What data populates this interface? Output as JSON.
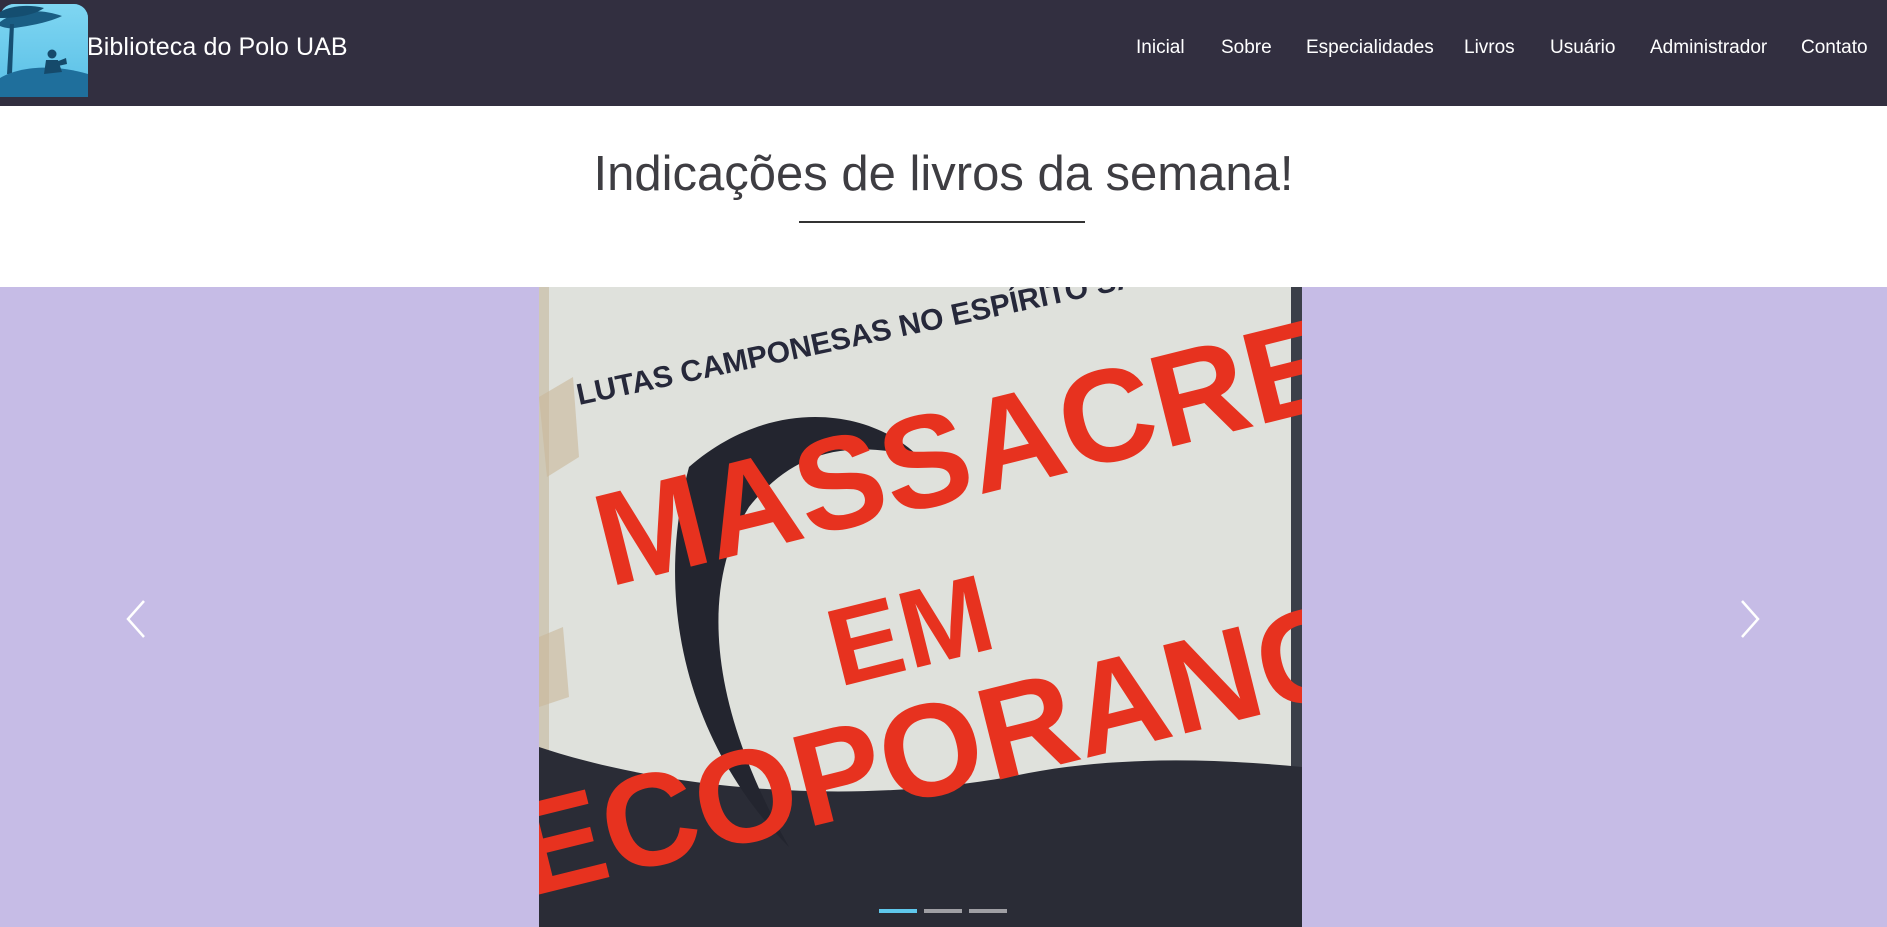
{
  "header": {
    "brand_name": "Biblioteca do Polo UAB",
    "logo_icon": "reading-under-tree-icon",
    "background_color": "#322f40"
  },
  "nav": {
    "items": [
      {
        "label": "Inicial"
      },
      {
        "label": "Sobre"
      },
      {
        "label": "Especialidades"
      },
      {
        "label": "Livros"
      },
      {
        "label": "Usuário"
      },
      {
        "label": "Administrador"
      },
      {
        "label": "Contato"
      }
    ]
  },
  "featured": {
    "title": "Indicações de livros da semana!"
  },
  "carousel": {
    "background_color": "#c6bce6",
    "slide_count": 3,
    "active_index": 0,
    "current_slide": {
      "cover_top_line": "LUTAS CAMPONESAS NO ESPÍRITO SANTO",
      "cover_title_lines": [
        "MASSACRE",
        "EM",
        "ECOPORANGA"
      ]
    },
    "prev_icon": "chevron-left-icon",
    "next_icon": "chevron-right-icon",
    "indicator_active_color": "#5fc8ec"
  }
}
